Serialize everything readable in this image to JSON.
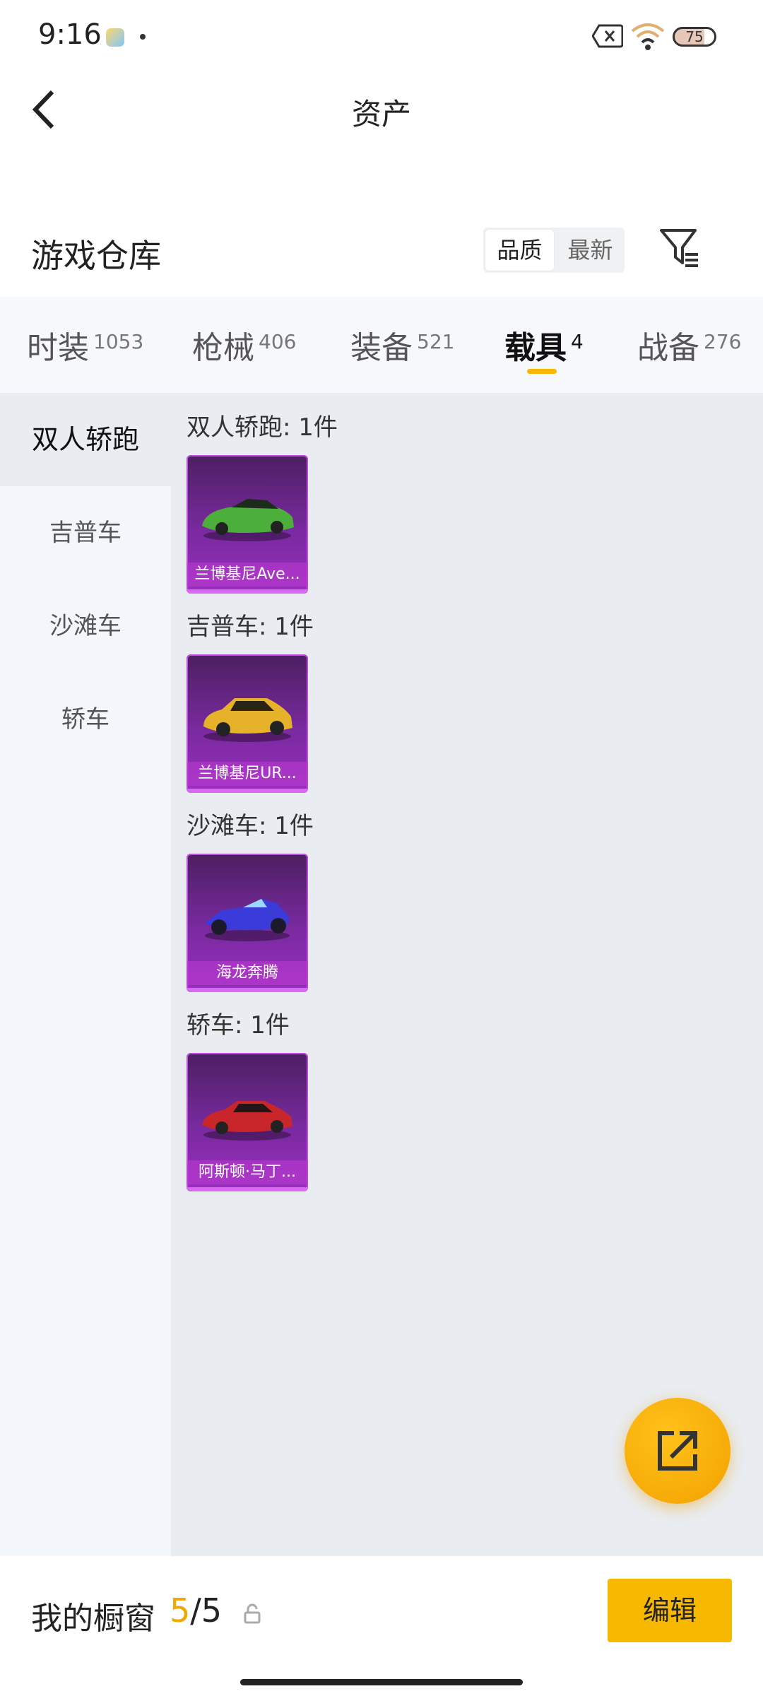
{
  "status_bar": {
    "time": "9:16",
    "battery": "75"
  },
  "header": {
    "title": "资产"
  },
  "warehouse": {
    "title": "游戏仓库",
    "sort_options": [
      "品质",
      "最新"
    ]
  },
  "tabs": [
    {
      "label": "时装",
      "count": "1053"
    },
    {
      "label": "枪械",
      "count": "406"
    },
    {
      "label": "装备",
      "count": "521"
    },
    {
      "label": "载具",
      "count": "4",
      "active": true
    },
    {
      "label": "战备",
      "count": "276"
    }
  ],
  "categories": [
    "双人轿跑",
    "吉普车",
    "沙滩车",
    "轿车"
  ],
  "groups": [
    {
      "title": "双人轿跑: 1件",
      "item_name": "兰博基尼Ave...",
      "car_color": "#4caf3c"
    },
    {
      "title": "吉普车: 1件",
      "item_name": "兰博基尼UR...",
      "car_color": "#e6b22a"
    },
    {
      "title": "沙滩车: 1件",
      "item_name": "海龙奔腾",
      "car_color": "#3a3bd8"
    },
    {
      "title": "轿车: 1件",
      "item_name": "阿斯顿·马丁...",
      "car_color": "#c8262a"
    }
  ],
  "showcase": {
    "label": "我的橱窗",
    "current": "5",
    "total": "/5",
    "edit_label": "编辑"
  }
}
